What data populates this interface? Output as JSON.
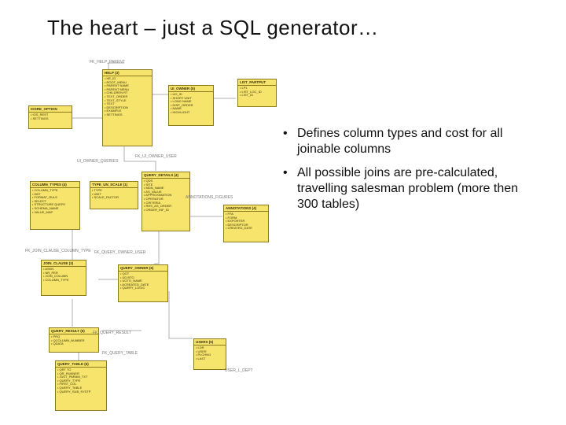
{
  "title": "The heart – just a SQL generator…",
  "bullets": [
    "Defines column types and cost for all joinable columns",
    "All possible joins are pre-calculated, travelling salesman problem (more then 300 tables)"
  ],
  "entities": {
    "help": {
      "name": "HELP (3)",
      "body": "• HE_ID\n• ROOT_MENU\n• PARENT NAME\n• PARENT MENU\n• CHILDREN RT\n• TEXT_ORDER\n• TEXT_STYLE\n• TEXT\n• DESCRIPTION\n• EXAMPLE\n• SETTINGS"
    },
    "ui_owner": {
      "name": "UI_OWNER (5)",
      "body": "• UO_ID\n• SHORT UNIT\n• LONG NAME\n• DISP_ORDER\n• NAME\n• HIGHLIGHT"
    },
    "list_partput": {
      "name": "LIST_PARTPUT",
      "body": "• LP1\n• LIST_LOC_ID\n• LIST_ID"
    },
    "iosre_option": {
      "name": "IOSRE_OPTION",
      "body": "• IOS_REST\n• SETTINGS"
    },
    "column_types": {
      "name": "COLUMN_TYPES (4)",
      "body": "• COLUMN_TYPE\n• DBT\n• FORMAT_RULE\n• SELECT\n• STRUCTURE QUERY\n• SCHEMA_NAME\n• VALUE_MAP"
    },
    "type_un_scale": {
      "name": "TYPE_UN_SCALE (1)",
      "body": "• TYPE\n• UNIT\n• SCALE_FACTOR"
    },
    "query_detail": {
      "name": "QUERY_DETAILS (4)",
      "body": "• QDS\n• SITE\n• MDN_NAME\n• AS_VALUE\n• APPROXIMATION\n• OPERATOR\n• CRITERIA\n• RHS_AS_ORDER\n• ORDER_INF_ID"
    },
    "annotations": {
      "name": "ANNOTATIONS (4)",
      "body": "• FFA\n• FORM\n• EXPORTER\n• DESCRIPTOR\n• CREATED_DATE"
    },
    "join_clause": {
      "name": "JOIN_CLAUSE (2)",
      "body": "• ASKN\n• NR_PER\n• JOIN_COLUMN\n• COLUMN_TYPE"
    },
    "query_owner": {
      "name": "QUERY_OWNER (6)",
      "body": "• QOT\n• UD BTO\n• UGTO_NAME\n• ACREATED_DATE\n• QUERY_LOGIC"
    },
    "query_result": {
      "name": "QUERY_RESULT (6)",
      "body": "• PRQ\n• QCOLUMN_NUMBER\n• QDATA"
    },
    "query_table": {
      "name": "QUERY_TABLE (6)",
      "body": "• QRT TO\n• QR_RUNNER\n• JUST_PARAM_TXT\n• QUERY_TYPE\n• FIRST_COL\n• QUERY_TABLE\n• QUERY_SUB_SYSTP"
    },
    "users": {
      "name": "USERS (5)",
      "body": "• LDR\n• USER\n• PLCHNG\n• LAST"
    }
  },
  "labels": {
    "help_parent": "FK_HELP_PARENT",
    "ui_owner_user": "FK_UI_OWNER_USER",
    "owner_queries": "UI_OWNER_QUERIES",
    "join_clause_col": "FK_JOIN_CLAUSE_COLUMN_TYPE",
    "query_owner_user": "FK_QUERY_OWNER_USER",
    "query_result_t": "FK_QUERY_RESULT",
    "query_table_rel": "FK_QUERY_TABLE",
    "annot_figures": "ANNOTATIONS_FIGURES",
    "user_dept": "USER_L_DEPT"
  }
}
